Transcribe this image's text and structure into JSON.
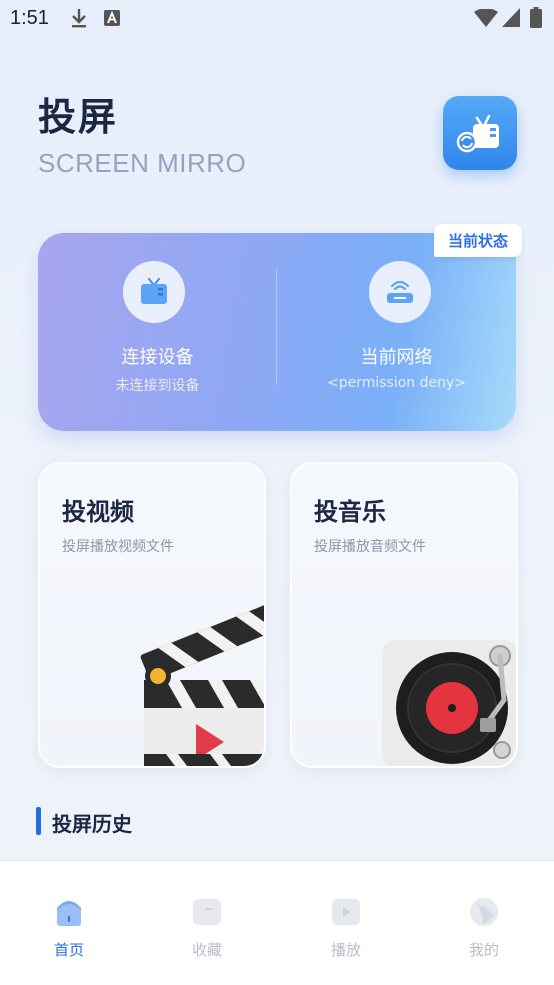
{
  "status_bar": {
    "time": "1:51"
  },
  "header": {
    "title": "投屏",
    "subtitle": "SCREEN MIRRO"
  },
  "status_card": {
    "tag": "当前状态",
    "device": {
      "label": "连接设备",
      "value": "未连接到设备"
    },
    "network": {
      "label": "当前网络",
      "value": "<permission deny>"
    }
  },
  "features": [
    {
      "title": "投视频",
      "subtitle": "投屏播放视频文件"
    },
    {
      "title": "投音乐",
      "subtitle": "投屏播放音频文件"
    }
  ],
  "history": {
    "title": "投屏历史"
  },
  "nav": {
    "items": [
      {
        "label": "首页",
        "icon": "home-icon",
        "active": true
      },
      {
        "label": "收藏",
        "icon": "folder-icon"
      },
      {
        "label": "播放",
        "icon": "play-icon"
      },
      {
        "label": "我的",
        "icon": "profile-icon"
      }
    ]
  },
  "colors": {
    "accent": "#2a6fe0",
    "nav_inactive": "#b6bcc8"
  }
}
